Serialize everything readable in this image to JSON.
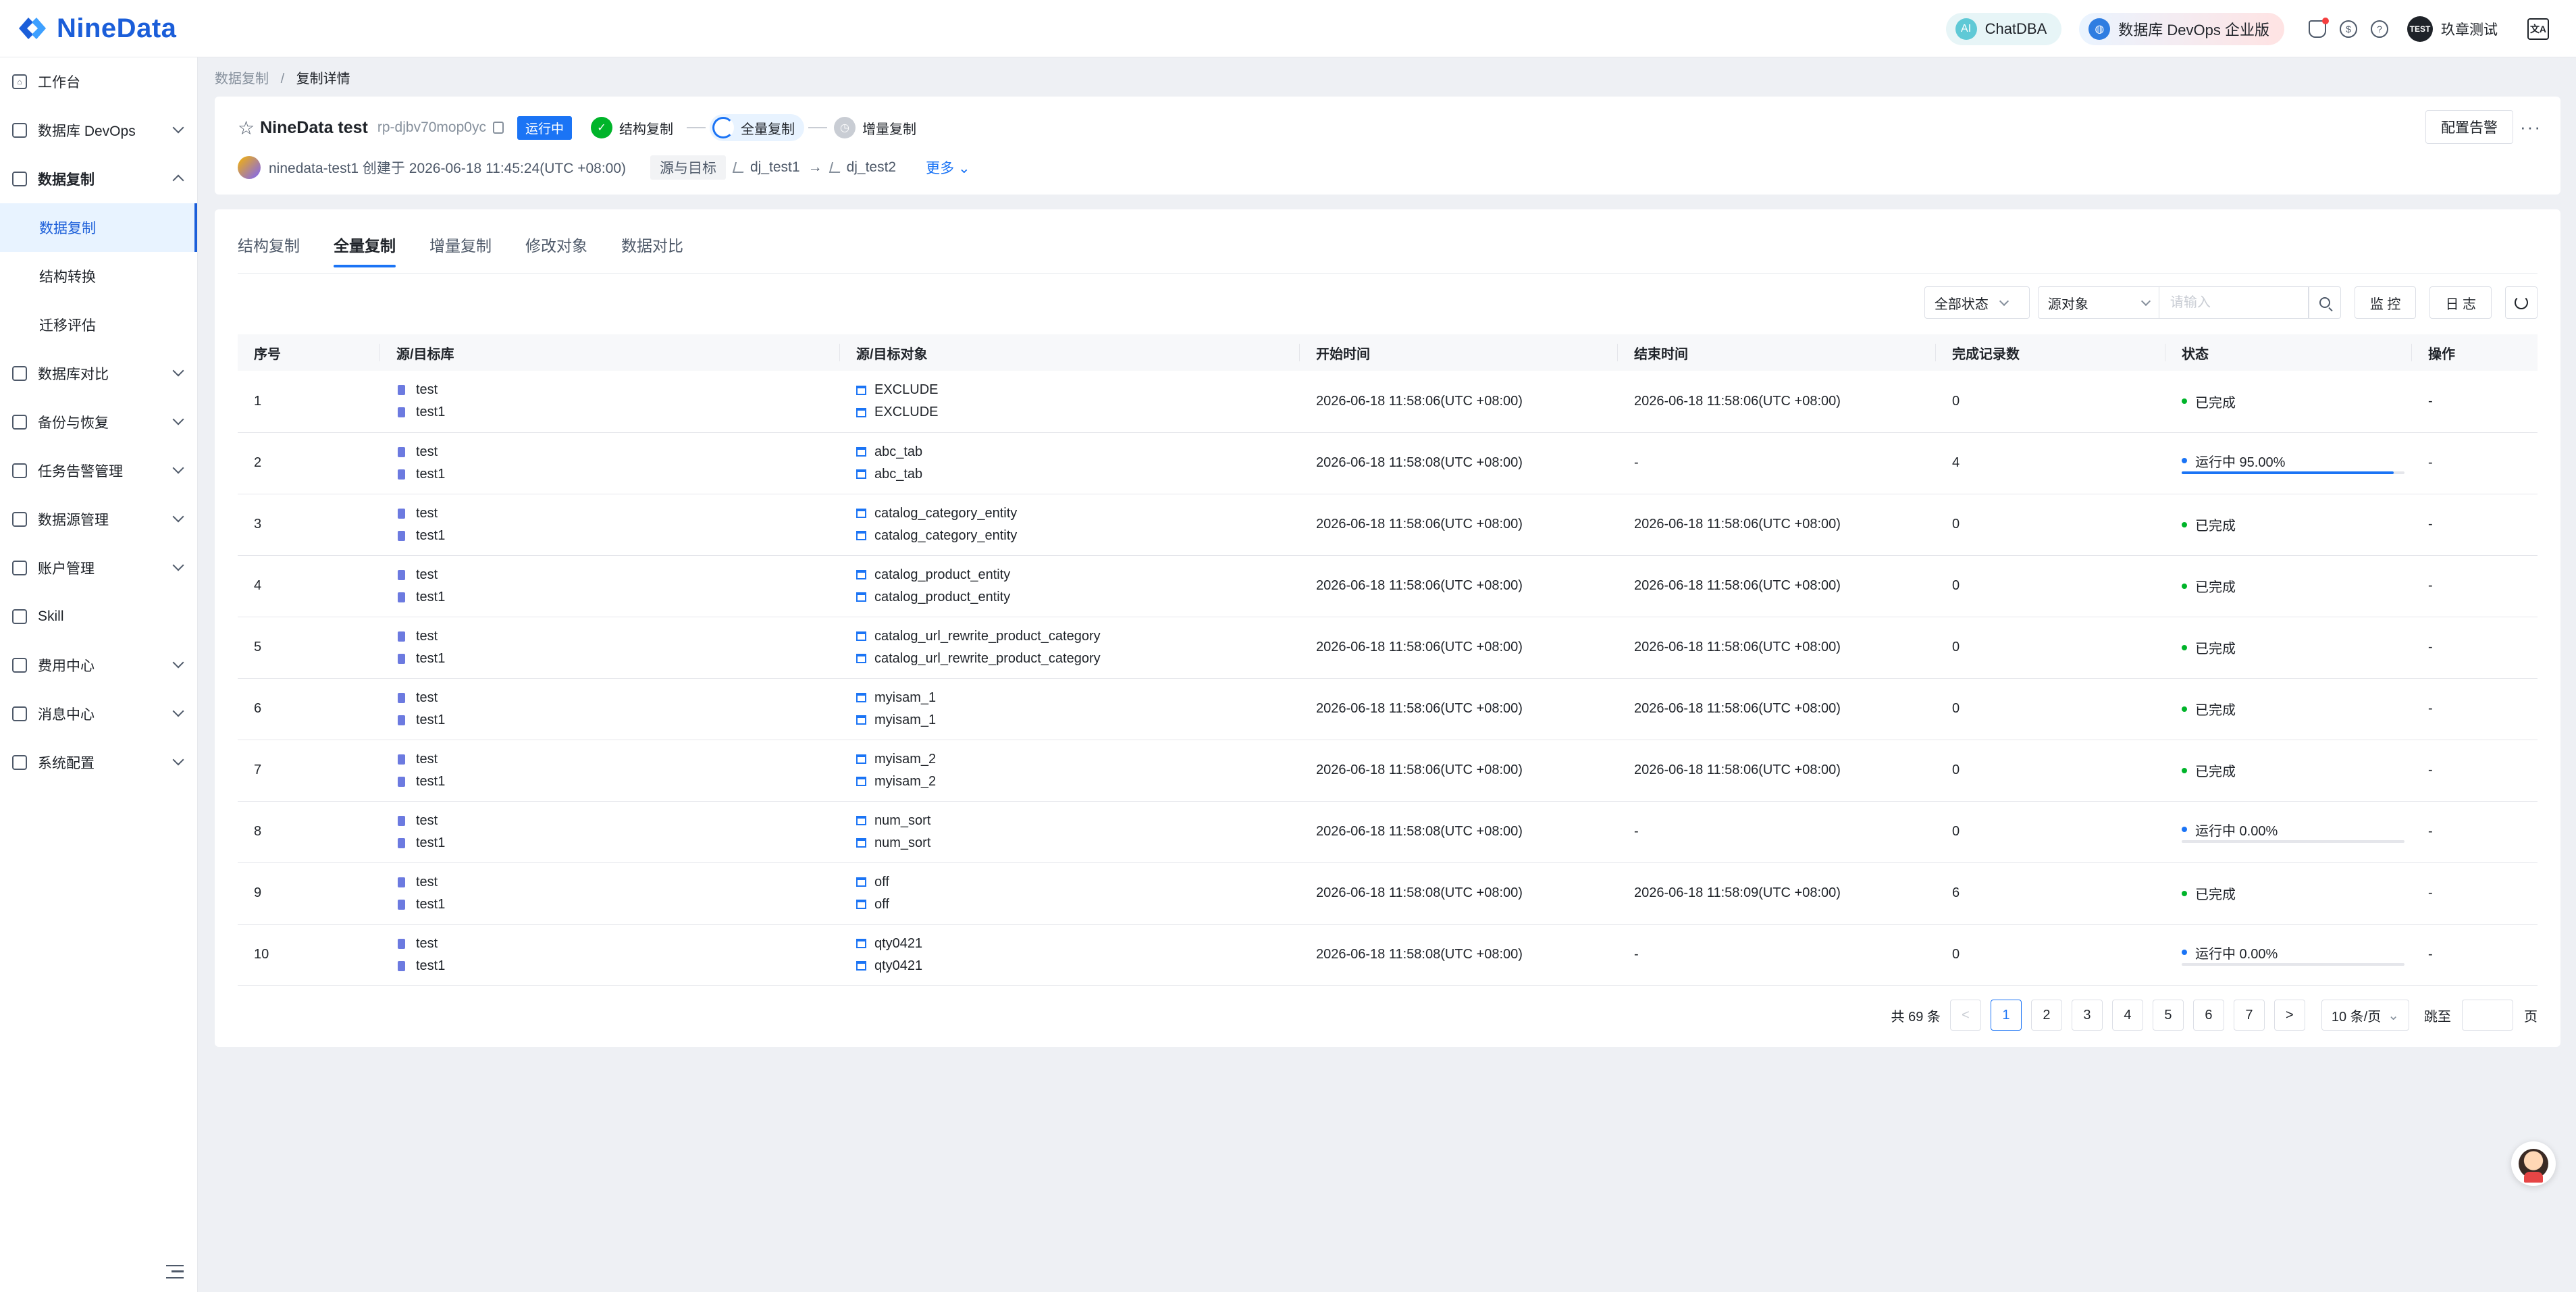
{
  "brand": {
    "name": "NineData"
  },
  "header": {
    "chatdba": "ChatDBA",
    "devops": "数据库 DevOps 企业版",
    "user": "玖章测试",
    "avatar_text": "TEST",
    "lang": "文A"
  },
  "sidebar": {
    "items": [
      {
        "label": "工作台"
      },
      {
        "label": "数据库 DevOps"
      },
      {
        "label": "数据复制"
      },
      {
        "label": "数据复制"
      },
      {
        "label": "结构转换"
      },
      {
        "label": "迁移评估"
      },
      {
        "label": "数据库对比"
      },
      {
        "label": "备份与恢复"
      },
      {
        "label": "任务告警管理"
      },
      {
        "label": "数据源管理"
      },
      {
        "label": "账户管理"
      },
      {
        "label": "Skill"
      },
      {
        "label": "费用中心"
      },
      {
        "label": "消息中心"
      },
      {
        "label": "系统配置"
      }
    ]
  },
  "breadcrumb": {
    "parent": "数据复制",
    "current": "复制详情",
    "sep": "/"
  },
  "task": {
    "name": "NineData test",
    "id": "rp-djbv70mop0yc",
    "status": "运行中",
    "steps": [
      "结构复制",
      "全量复制",
      "增量复制"
    ],
    "alert_button": "配置告警",
    "more_dots": "···",
    "creator_line": "ninedata-test1 创建于 2026-06-18 11:45:24(UTC +08:00)",
    "src_tag": "源与目标",
    "source": "dj_test1",
    "arrow": "→",
    "target": "dj_test2",
    "more": "更多"
  },
  "tabs": [
    "结构复制",
    "全量复制",
    "增量复制",
    "修改对象",
    "数据对比"
  ],
  "toolbar": {
    "status_filter": "全部状态",
    "object_filter": "源对象",
    "search_placeholder": "请输入",
    "monitor": "监 控",
    "log": "日 志"
  },
  "table": {
    "headers": [
      "序号",
      "源/目标库",
      "源/目标对象",
      "开始时间",
      "结束时间",
      "完成记录数",
      "状态",
      "操作"
    ],
    "rows": [
      {
        "idx": "1",
        "src_db": "test",
        "dst_db": "test1",
        "src_obj": "EXCLUDE",
        "dst_obj": "EXCLUDE",
        "start": "2026-06-18 11:58:06(UTC +08:00)",
        "end": "2026-06-18 11:58:06(UTC +08:00)",
        "count": "0",
        "status": "已完成",
        "op": "-"
      },
      {
        "idx": "2",
        "src_db": "test",
        "dst_db": "test1",
        "src_obj": "abc_tab",
        "dst_obj": "abc_tab",
        "start": "2026-06-18 11:58:08(UTC +08:00)",
        "end": "-",
        "count": "4",
        "status": "运行中 95.00%",
        "progress": 0.95,
        "op": "-"
      },
      {
        "idx": "3",
        "src_db": "test",
        "dst_db": "test1",
        "src_obj": "catalog_category_entity",
        "dst_obj": "catalog_category_entity",
        "start": "2026-06-18 11:58:06(UTC +08:00)",
        "end": "2026-06-18 11:58:06(UTC +08:00)",
        "count": "0",
        "status": "已完成",
        "op": "-"
      },
      {
        "idx": "4",
        "src_db": "test",
        "dst_db": "test1",
        "src_obj": "catalog_product_entity",
        "dst_obj": "catalog_product_entity",
        "start": "2026-06-18 11:58:06(UTC +08:00)",
        "end": "2026-06-18 11:58:06(UTC +08:00)",
        "count": "0",
        "status": "已完成",
        "op": "-"
      },
      {
        "idx": "5",
        "src_db": "test",
        "dst_db": "test1",
        "src_obj": "catalog_url_rewrite_product_category",
        "dst_obj": "catalog_url_rewrite_product_category",
        "start": "2026-06-18 11:58:06(UTC +08:00)",
        "end": "2026-06-18 11:58:06(UTC +08:00)",
        "count": "0",
        "status": "已完成",
        "op": "-"
      },
      {
        "idx": "6",
        "src_db": "test",
        "dst_db": "test1",
        "src_obj": "myisam_1",
        "dst_obj": "myisam_1",
        "start": "2026-06-18 11:58:06(UTC +08:00)",
        "end": "2026-06-18 11:58:06(UTC +08:00)",
        "count": "0",
        "status": "已完成",
        "op": "-"
      },
      {
        "idx": "7",
        "src_db": "test",
        "dst_db": "test1",
        "src_obj": "myisam_2",
        "dst_obj": "myisam_2",
        "start": "2026-06-18 11:58:06(UTC +08:00)",
        "end": "2026-06-18 11:58:06(UTC +08:00)",
        "count": "0",
        "status": "已完成",
        "op": "-"
      },
      {
        "idx": "8",
        "src_db": "test",
        "dst_db": "test1",
        "src_obj": "num_sort",
        "dst_obj": "num_sort",
        "start": "2026-06-18 11:58:08(UTC +08:00)",
        "end": "-",
        "count": "0",
        "status": "运行中 0.00%",
        "progress": 0.0,
        "op": "-"
      },
      {
        "idx": "9",
        "src_db": "test",
        "dst_db": "test1",
        "src_obj": "off",
        "dst_obj": "off",
        "start": "2026-06-18 11:58:08(UTC +08:00)",
        "end": "2026-06-18 11:58:09(UTC +08:00)",
        "count": "6",
        "status": "已完成",
        "op": "-"
      },
      {
        "idx": "10",
        "src_db": "test",
        "dst_db": "test1",
        "src_obj": "qty0421",
        "dst_obj": "qty0421",
        "start": "2026-06-18 11:58:08(UTC +08:00)",
        "end": "-",
        "count": "0",
        "status": "运行中 0.00%",
        "progress": 0.0,
        "op": "-"
      }
    ]
  },
  "pagination": {
    "total": "共 69 条",
    "prev": "<",
    "next": ">",
    "pages": [
      "1",
      "2",
      "3",
      "4",
      "5",
      "6",
      "7"
    ],
    "current": "1",
    "page_size": "10 条/页",
    "jump_label": "跳至",
    "page_suffix": "页"
  },
  "colors": {
    "accent": "#1b74f5",
    "success": "#00b42a",
    "brand": "#1b5ed9"
  }
}
